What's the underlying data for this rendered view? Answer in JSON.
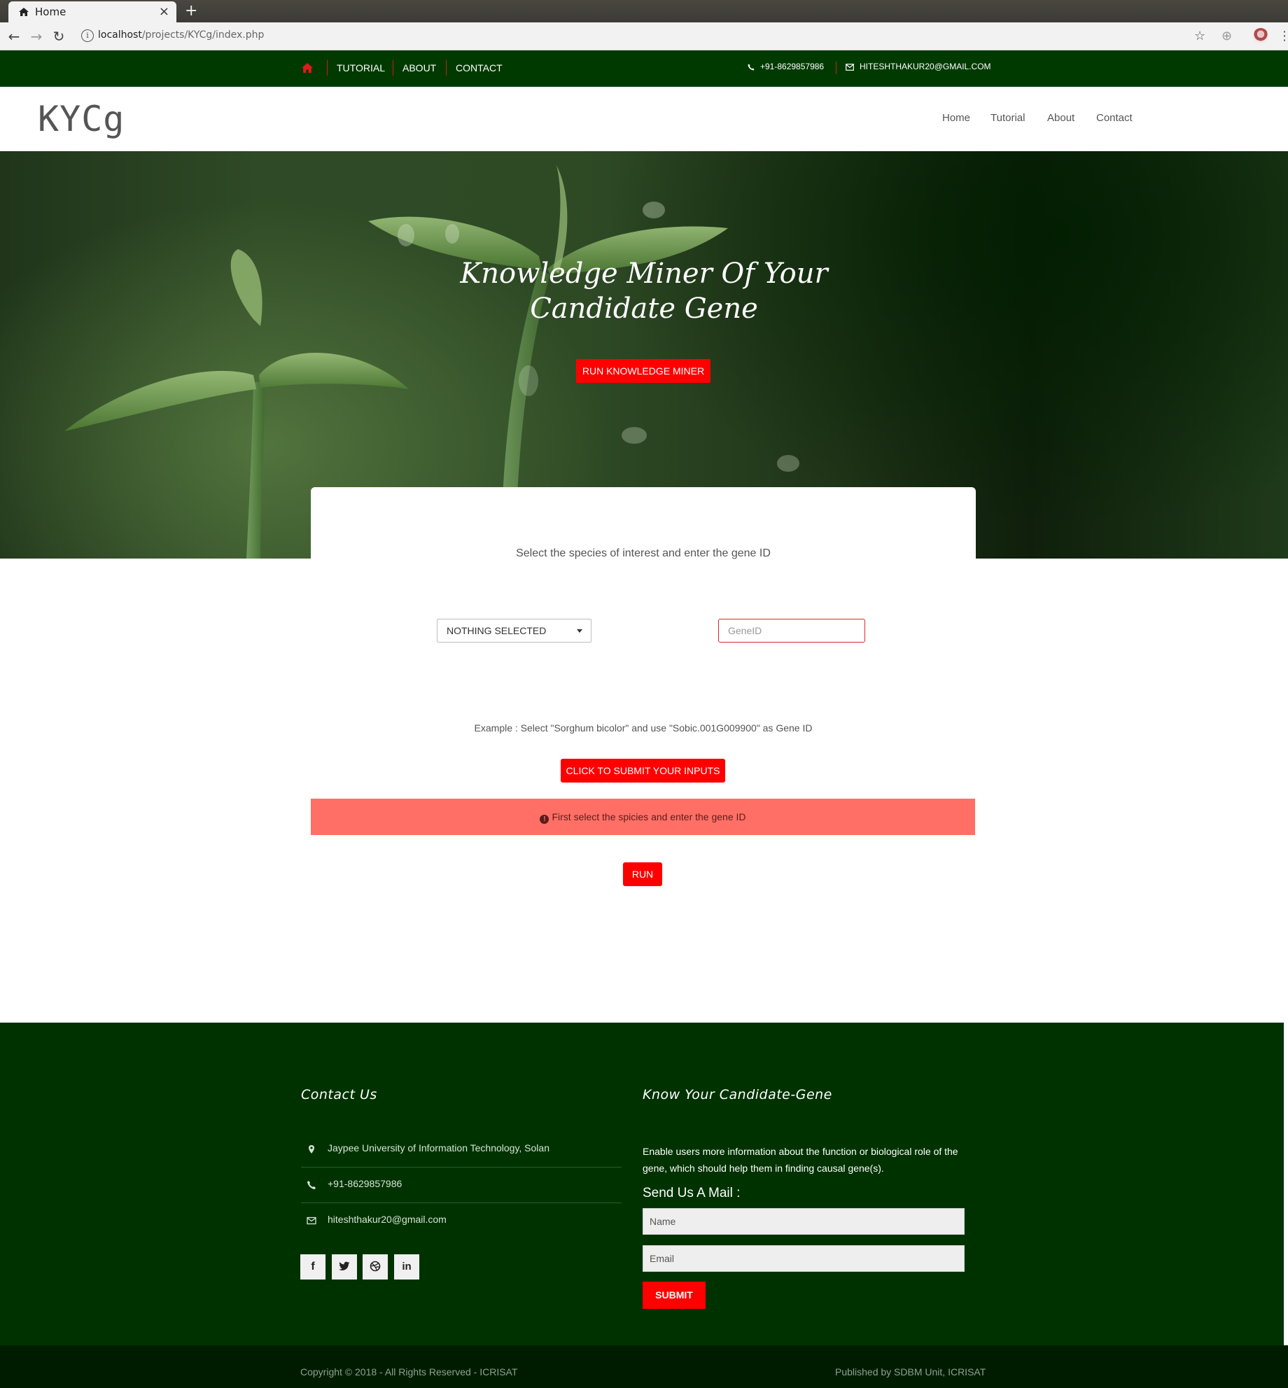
{
  "browser": {
    "tab_title": "Home",
    "tab_close": "×",
    "new_tab": "+",
    "url_host": "localhost",
    "url_path": "/projects/KYCg/index.php"
  },
  "topbar": {
    "items": [
      "TUTORIAL",
      "ABOUT",
      "CONTACT"
    ],
    "phone": "+91-8629857986",
    "email": "HITESHTHAKUR20@GMAIL.COM"
  },
  "header": {
    "logo": "KYCg",
    "nav": [
      "Home",
      "Tutorial",
      "About",
      "Contact"
    ]
  },
  "hero": {
    "title_line1": "Knowledge Miner Of Your",
    "title_line2": "Candidate Gene",
    "button": "RUN KNOWLEDGE MINER"
  },
  "form": {
    "instruction": "Select the species of interest and enter the gene ID",
    "species_selected": "NOTHING SELECTED",
    "gene_placeholder": "GeneID",
    "example": "Example : Select \"Sorghum bicolor\" and use \"Sobic.001G009900\" as Gene ID",
    "submit_label": "CLICK TO SUBMIT YOUR INPUTS",
    "alert": "First select the spicies and enter the gene ID",
    "run_label": "RUN"
  },
  "footer": {
    "contact_heading": "Contact Us",
    "address": "Jaypee University of Information Technology, Solan",
    "phone": "+91-8629857986",
    "email": "hiteshthakur20@gmail.com",
    "social": [
      "facebook-icon",
      "twitter-icon",
      "dribbble-icon",
      "linkedin-icon"
    ],
    "about_heading": "Know Your Candidate-Gene",
    "about_text": "Enable users more information about the function or biological role of the gene, which should help them in finding causal gene(s).",
    "mail_heading": "Send Us A Mail :",
    "name_placeholder": "Name",
    "email_placeholder": "Email",
    "submit_label": "SUBMIT",
    "copyright": "Copyright © 2018 - All Rights Reserved - ICRISAT",
    "published": "Published by SDBM Unit, ICRISAT"
  },
  "colors": {
    "dark_green": "#003a00",
    "accent_red": "#ff0000",
    "alert_bg": "#ff6f65"
  }
}
